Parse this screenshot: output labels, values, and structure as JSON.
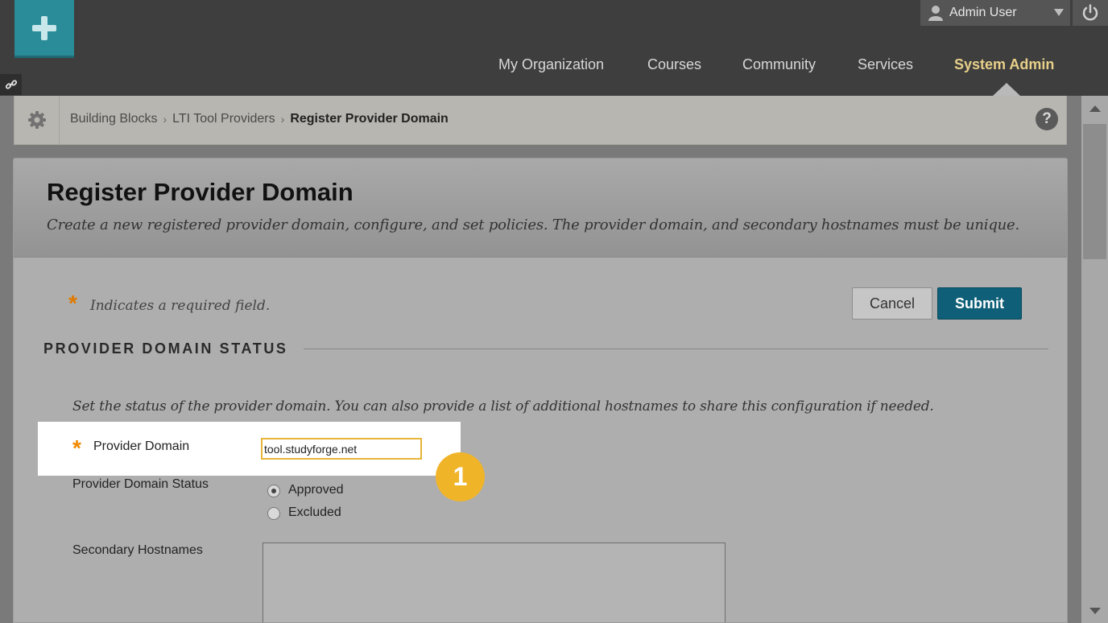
{
  "header": {
    "user_name": "Admin User",
    "nav": [
      {
        "label": "My Organization"
      },
      {
        "label": "Courses"
      },
      {
        "label": "Community"
      },
      {
        "label": "Services"
      },
      {
        "label": "System Admin",
        "active": true
      }
    ]
  },
  "breadcrumb": {
    "items": [
      "Building Blocks",
      "LTI Tool Providers"
    ],
    "current": "Register Provider Domain",
    "help": "?"
  },
  "page": {
    "title": "Register Provider Domain",
    "subtitle": "Create a new registered provider domain, configure, and set policies. The provider domain, and secondary hostnames must be unique."
  },
  "form": {
    "required_note": "Indicates a required field.",
    "required_mark": "*",
    "cancel_label": "Cancel",
    "submit_label": "Submit",
    "section_title": "PROVIDER DOMAIN STATUS",
    "section_desc": "Set the status of the provider domain. You can also provide a list of additional hostnames to share this configuration if needed.",
    "provider_domain_label": "Provider Domain",
    "provider_domain_value": "tool.studyforge.net",
    "status_label": "Provider Domain Status",
    "status_options": [
      "Approved",
      "Excluded"
    ],
    "status_selected": "Approved",
    "secondary_label": "Secondary Hostnames",
    "secondary_value": ""
  },
  "annotation": {
    "step_number": "1",
    "color": "#f0b429"
  },
  "colors": {
    "topbar": "#3e3e3e",
    "logo": "#2a8c98",
    "active_nav": "#e8d08a",
    "submit": "#0e5f77",
    "required": "#e07a00"
  }
}
